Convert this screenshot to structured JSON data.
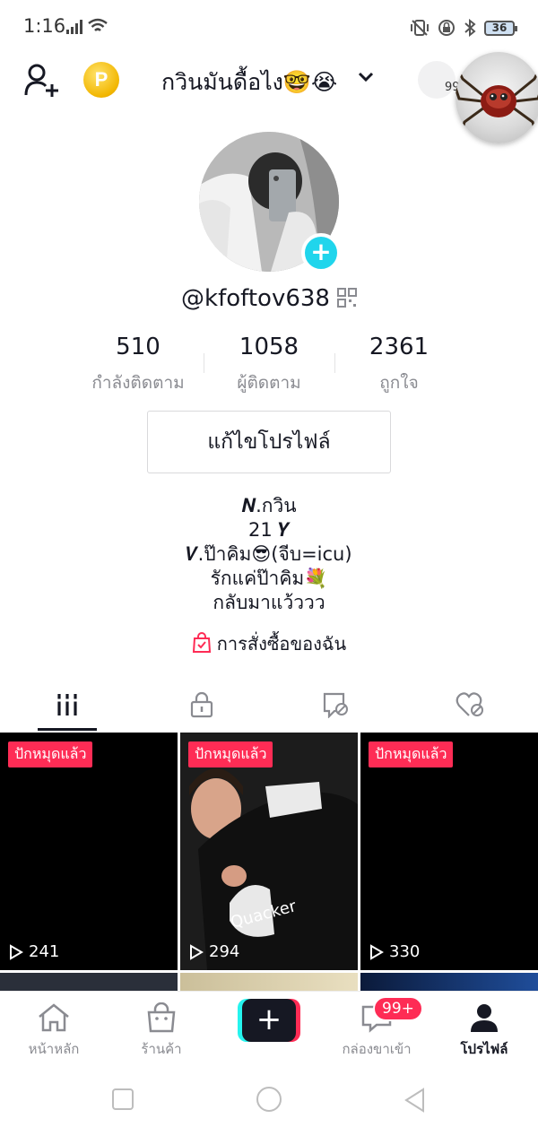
{
  "status_bar": {
    "time": "1:16",
    "battery": "36"
  },
  "header": {
    "coin_letter": "P",
    "account_name": "กวินมันดื้อไง🤓😭",
    "notif_count": "99"
  },
  "profile": {
    "username": "@kfoftov638",
    "stats": [
      {
        "value": "510",
        "label": "กำลังติดตาม"
      },
      {
        "value": "1058",
        "label": "ผู้ติดตาม"
      },
      {
        "value": "2361",
        "label": "ถูกใจ"
      }
    ],
    "edit_button": "แก้ไขโปรไฟล์",
    "bio": [
      "𝑵.กวิน",
      "21 𝒀",
      "𝑽.ป๊าคิม😎(จีบ=icu)",
      "รักแค่ป๊าคิม💐",
      "กลับมาแว้ววว"
    ],
    "orders_link": "การสั่งซื้อของฉัน"
  },
  "tabs": [
    "videos-grid-icon",
    "private-lock-icon",
    "hidden-reposts-icon",
    "liked-hidden-icon"
  ],
  "videos": [
    {
      "badge": "ปักหมุดแล้ว",
      "plays": "241"
    },
    {
      "badge": "ปักหมุดแล้ว",
      "plays": "294"
    },
    {
      "badge": "ปักหมุดแล้ว",
      "plays": "330"
    }
  ],
  "bottom_nav": {
    "home": "หน้าหลัก",
    "shop": "ร้านค้า",
    "inbox": "กล่องขาเข้า",
    "inbox_badge": "99+",
    "profile": "โปรไฟล์"
  },
  "colors": {
    "accent": "#fe2c55",
    "cyan": "#25f4ee",
    "text": "#161823",
    "muted": "#8a8b91"
  }
}
